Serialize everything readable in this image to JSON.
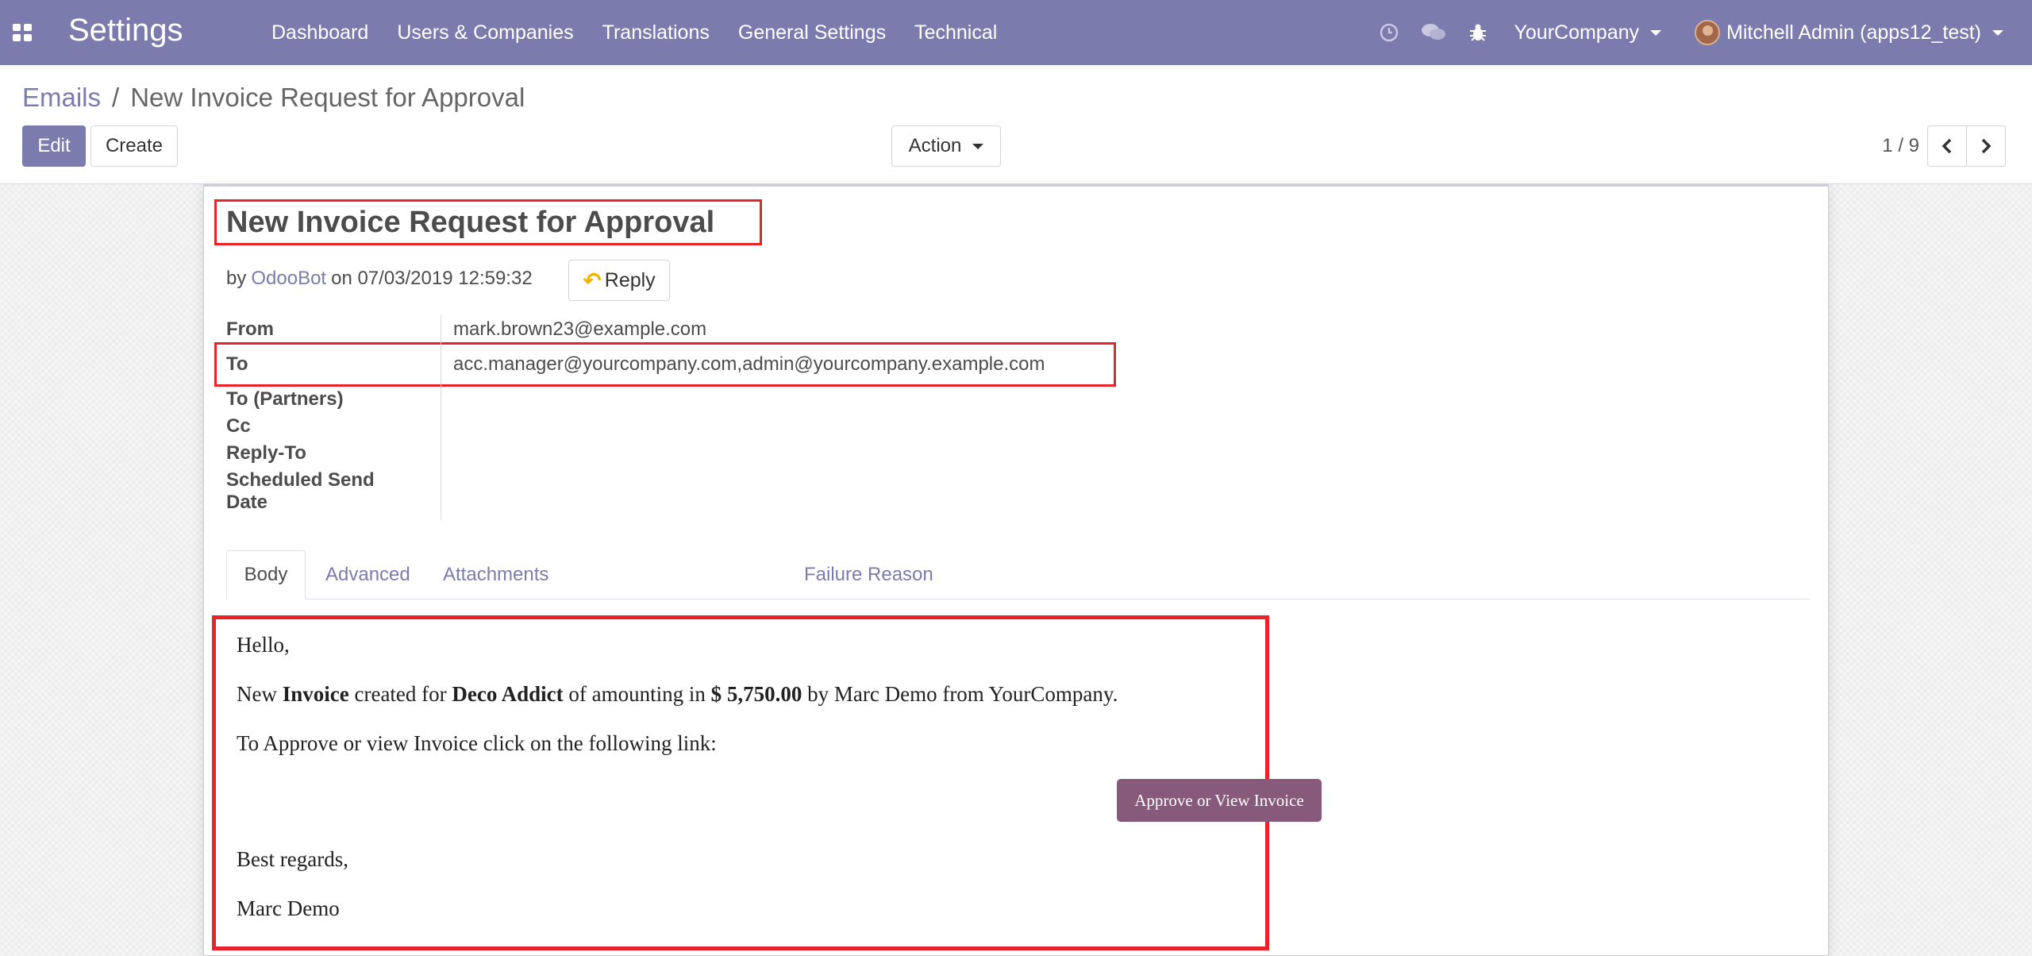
{
  "navbar": {
    "brand": "Settings",
    "menu": [
      "Dashboard",
      "Users & Companies",
      "Translations",
      "General Settings",
      "Technical"
    ],
    "company": "YourCompany",
    "user": "Mitchell Admin (apps12_test)",
    "color": "#7c7bad",
    "icons": [
      "apps-icon",
      "clock-icon",
      "chat-icon",
      "bug-icon"
    ]
  },
  "breadcrumb": {
    "parent": "Emails",
    "separator": "/",
    "current": "New Invoice Request for Approval"
  },
  "control": {
    "edit_label": "Edit",
    "create_label": "Create",
    "action_label": "Action",
    "pager": "1 / 9"
  },
  "email": {
    "subject": "New Invoice Request for Approval",
    "by_prefix": "by",
    "author": "OdooBot",
    "on_date": "on 07/03/2019 12:59:32",
    "reply_label": "Reply",
    "fields": [
      {
        "label": "From",
        "value": "mark.brown23@example.com"
      },
      {
        "label": "To",
        "value": "acc.manager@yourcompany.com,admin@yourcompany.example.com"
      },
      {
        "label": "To (Partners)",
        "value": ""
      },
      {
        "label": "Cc",
        "value": ""
      },
      {
        "label": "Reply-To",
        "value": ""
      },
      {
        "label": "Scheduled Send",
        "value": ""
      },
      {
        "label": "Date",
        "value": ""
      }
    ]
  },
  "tabs": [
    "Body",
    "Advanced",
    "Attachments",
    "Failure Reason"
  ],
  "body": {
    "greeting": "Hello,",
    "line_1": {
      "pre": "New ",
      "b1": "Invoice",
      "mid1": " created for ",
      "b2": "Deco Addict",
      "mid2": " of amounting in ",
      "b3": "$ 5,750.00",
      "post": " by Marc Demo from YourCompany."
    },
    "line_2": "To Approve or view Invoice click on the following link:",
    "button_label": "Approve or View Invoice",
    "button_color": "#875a7b",
    "closing": "Best regards,",
    "signature": "Marc Demo"
  },
  "highlight_color": "#e8232a"
}
